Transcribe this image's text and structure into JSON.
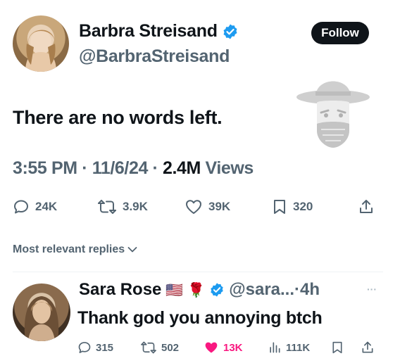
{
  "tweet": {
    "author_name": "Barbra Streisand",
    "author_handle": "@BarbraStreisand",
    "follow_label": "Follow",
    "text": "There are no words left.",
    "time": "3:55 PM",
    "date": "11/6/24",
    "views_count": "2.4M",
    "views_label": "Views",
    "stats": {
      "replies": "24K",
      "reposts": "3.9K",
      "likes": "39K",
      "bookmarks": "320"
    }
  },
  "replies_filter_label": "Most relevant replies",
  "reply": {
    "author_name": "Sara Rose",
    "flag": "🇺🇸",
    "rose": "🌹",
    "author_handle": "@sara...",
    "time": "4h",
    "more": "···",
    "text": "Thank god you annoying btch",
    "stats": {
      "replies": "315",
      "reposts": "502",
      "likes": "13K",
      "views": "111K"
    }
  },
  "colors": {
    "verified": "#1d9bf0",
    "like_active": "#f91880",
    "text_primary": "#0f1419",
    "text_secondary": "#536471"
  }
}
